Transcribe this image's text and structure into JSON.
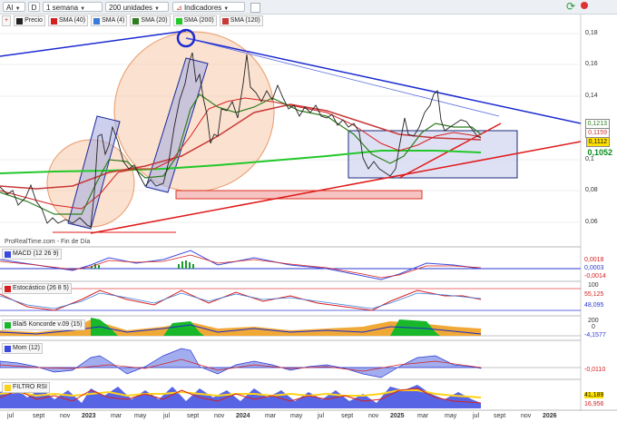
{
  "toolbar": {
    "symbol": "AI",
    "mode": "D",
    "period": "1 semana",
    "units": "200 unidades",
    "indicators": "Indicadores"
  },
  "legend": [
    {
      "label": "Precio",
      "color": "#222222"
    },
    {
      "label": "SMA (40)",
      "color": "#d62020"
    },
    {
      "label": "SMA (4)",
      "color": "#3a7ad9"
    },
    {
      "label": "SMA (20)",
      "color": "#2e7d1e"
    },
    {
      "label": "SMA (200)",
      "color": "#22c82a"
    },
    {
      "label": "SMA (120)",
      "color": "#c73838"
    }
  ],
  "watermark": "ProRealTime.com - Fin de Día",
  "price_axis": {
    "ticks": [
      "0,18",
      "0,16",
      "0,14",
      "0,1213",
      "0,1159",
      "0,1112",
      "0,1",
      "0,08",
      "0,06"
    ],
    "last_price": "0,1052",
    "price_labels": {
      "sma20": "0,1213",
      "sma40": "0,1159",
      "last": "0,1112"
    }
  },
  "panels": {
    "macd": {
      "title": "MACD (12 26 9)",
      "values": [
        "0,0018",
        "0,0003",
        "-0,0014"
      ]
    },
    "stoch": {
      "title": "Estocástico (26 8 5)",
      "ticks": [
        "100"
      ],
      "values": [
        "55,125",
        "48,095"
      ]
    },
    "blai": {
      "title": "Blai5 Koncorde v.09 (15)",
      "ticks": [
        "200",
        "0"
      ],
      "values": [
        "-4,1577"
      ]
    },
    "mom": {
      "title": "Mom (12)",
      "values": [
        "-0,0110"
      ]
    },
    "rsi": {
      "title": "FILTRO RSI",
      "values": [
        "41,189",
        "16,956"
      ]
    }
  },
  "x_axis": [
    {
      "label": "jul",
      "bold": false
    },
    {
      "label": "sept",
      "bold": false
    },
    {
      "label": "nov",
      "bold": false
    },
    {
      "label": "2023",
      "bold": true
    },
    {
      "label": "mar",
      "bold": false
    },
    {
      "label": "may",
      "bold": false
    },
    {
      "label": "jul",
      "bold": false
    },
    {
      "label": "sept",
      "bold": false
    },
    {
      "label": "nov",
      "bold": false
    },
    {
      "label": "2024",
      "bold": true
    },
    {
      "label": "mar",
      "bold": false
    },
    {
      "label": "may",
      "bold": false
    },
    {
      "label": "jul",
      "bold": false
    },
    {
      "label": "sept",
      "bold": false
    },
    {
      "label": "nov",
      "bold": false
    },
    {
      "label": "2025",
      "bold": true
    },
    {
      "label": "mar",
      "bold": false
    },
    {
      "label": "may",
      "bold": false
    },
    {
      "label": "jul",
      "bold": false
    },
    {
      "label": "sept",
      "bold": false
    },
    {
      "label": "nov",
      "bold": false
    },
    {
      "label": "2026",
      "bold": true
    }
  ],
  "icons": [
    "grid-icon",
    "compare-icon",
    "refresh-icon"
  ]
}
